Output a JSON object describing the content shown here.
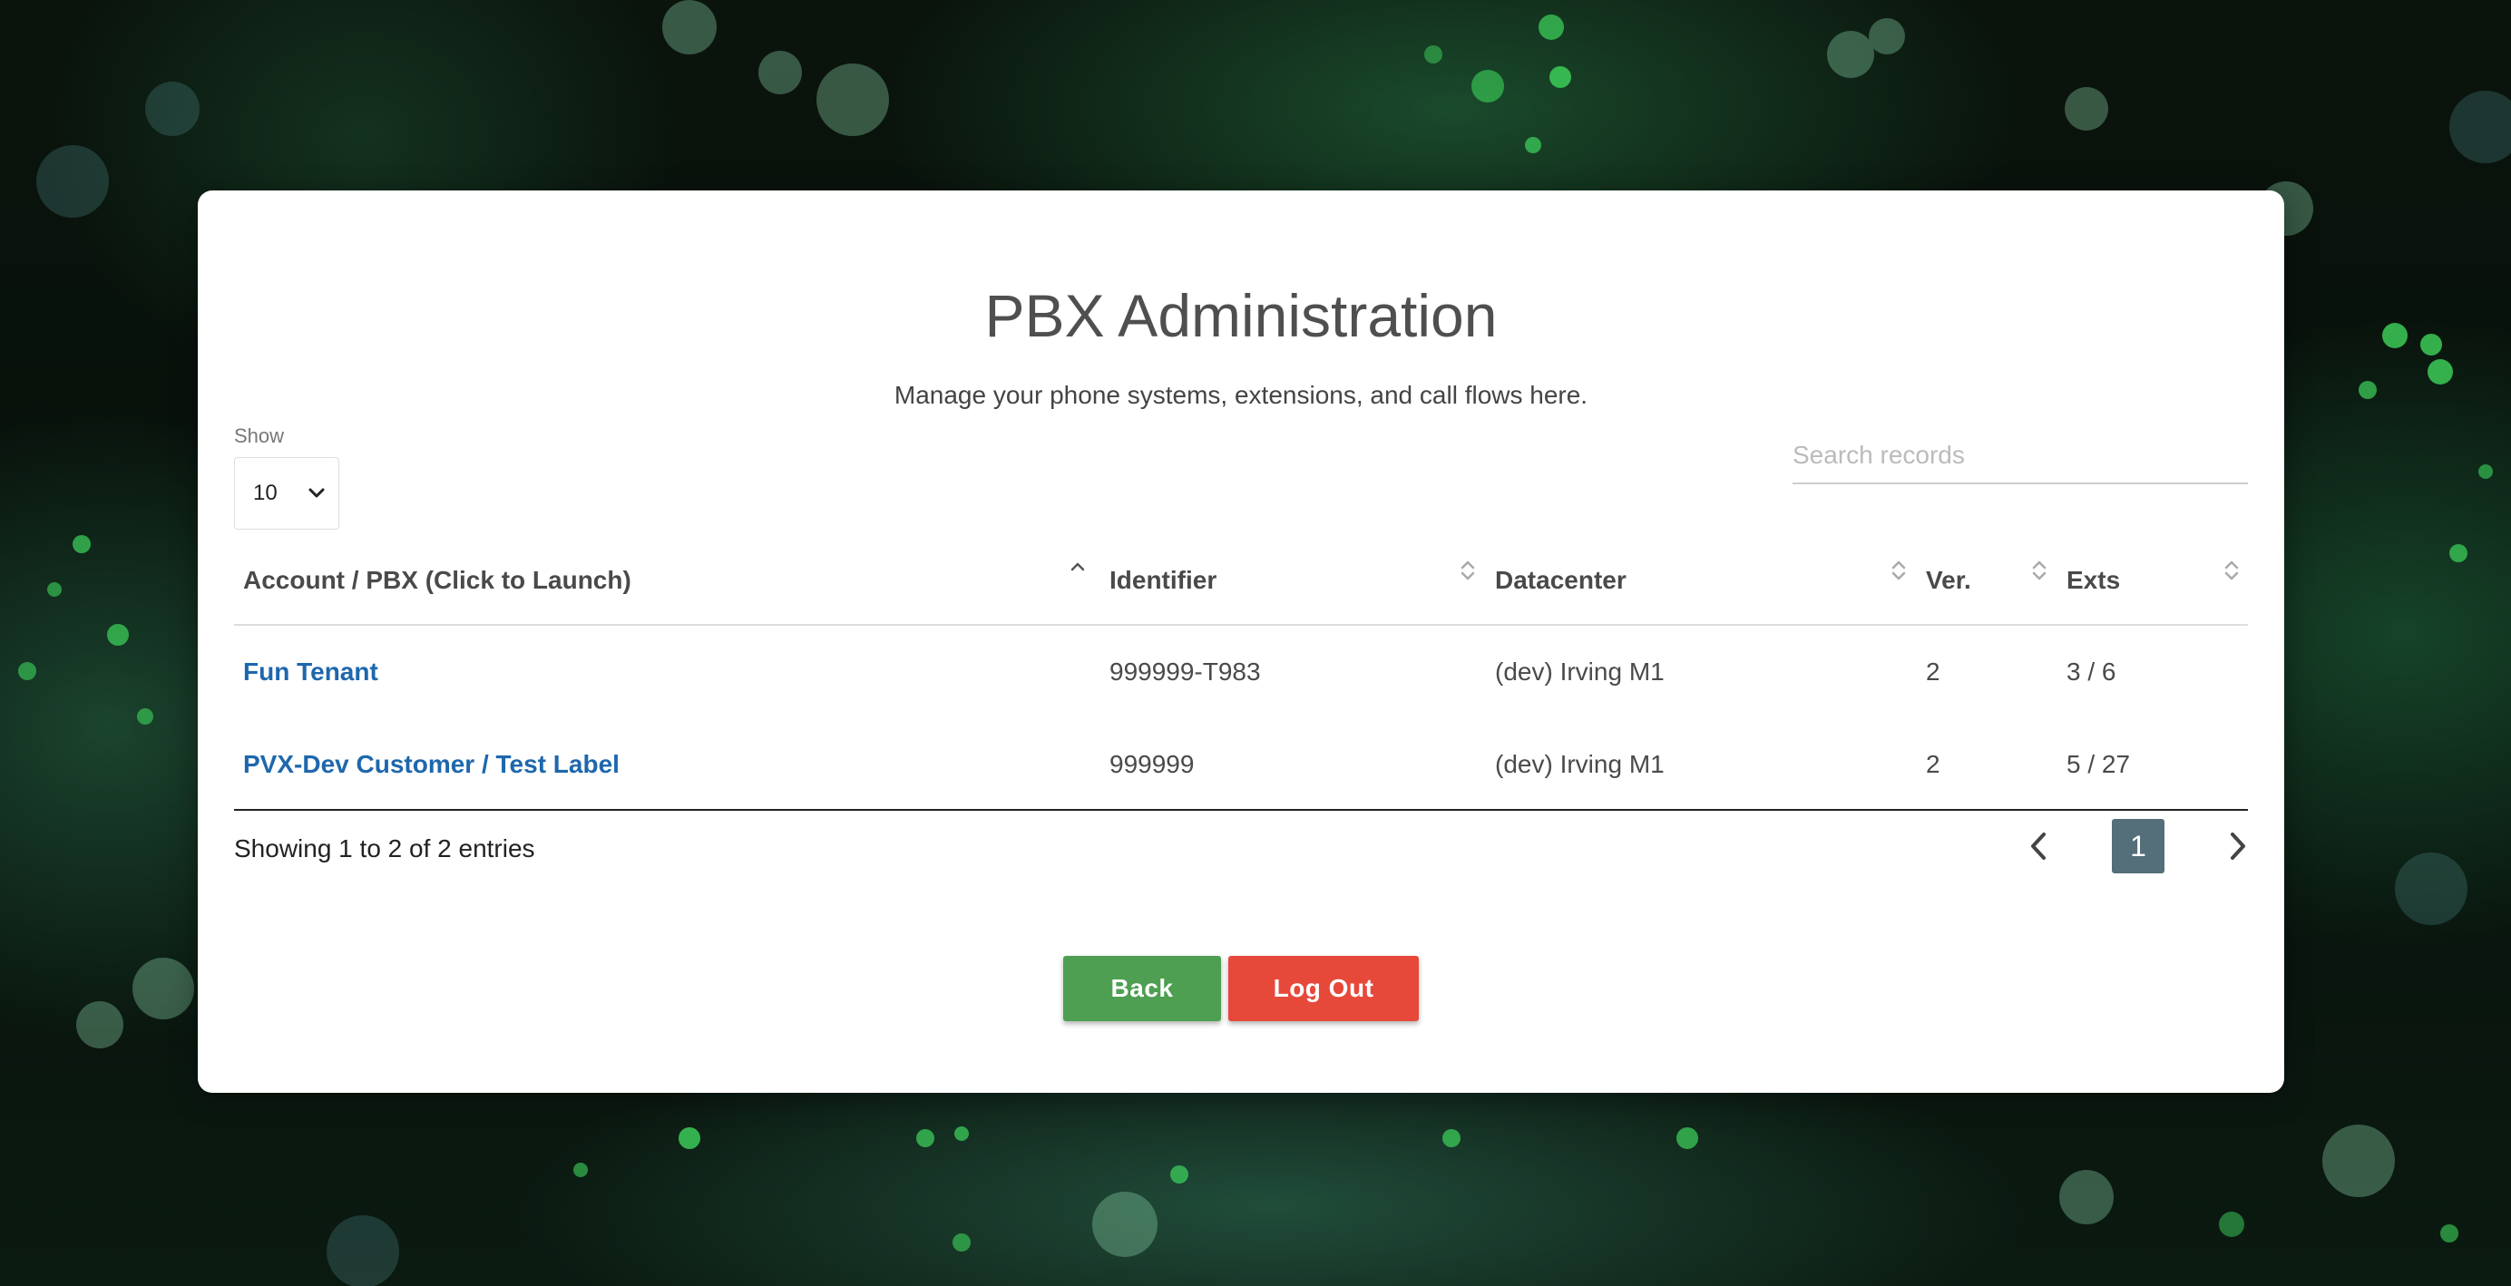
{
  "page": {
    "title": "PBX Administration",
    "subtitle": "Manage your phone systems, extensions, and call flows here."
  },
  "length": {
    "label": "Show",
    "value": "10"
  },
  "search": {
    "placeholder": "Search records"
  },
  "table": {
    "columns": [
      "Account / PBX (Click to Launch)",
      "Identifier",
      "Datacenter",
      "Ver.",
      "Exts"
    ],
    "rows": [
      {
        "account": "Fun Tenant",
        "identifier": "999999-T983",
        "datacenter": "(dev) Irving M1",
        "version": "2",
        "exts": "3 / 6"
      },
      {
        "account": "PVX-Dev Customer / Test Label",
        "identifier": "999999",
        "datacenter": "(dev) Irving M1",
        "version": "2",
        "exts": "5 / 27"
      }
    ]
  },
  "info": "Showing 1 to 2 of 2 entries",
  "pagination": {
    "current": "1"
  },
  "buttons": {
    "back": "Back",
    "logout": "Log Out"
  },
  "colors": {
    "link": "#1e67ad",
    "back_button": "#4e9f51",
    "logout_button": "#e6493a",
    "active_page": "#546e7a"
  }
}
